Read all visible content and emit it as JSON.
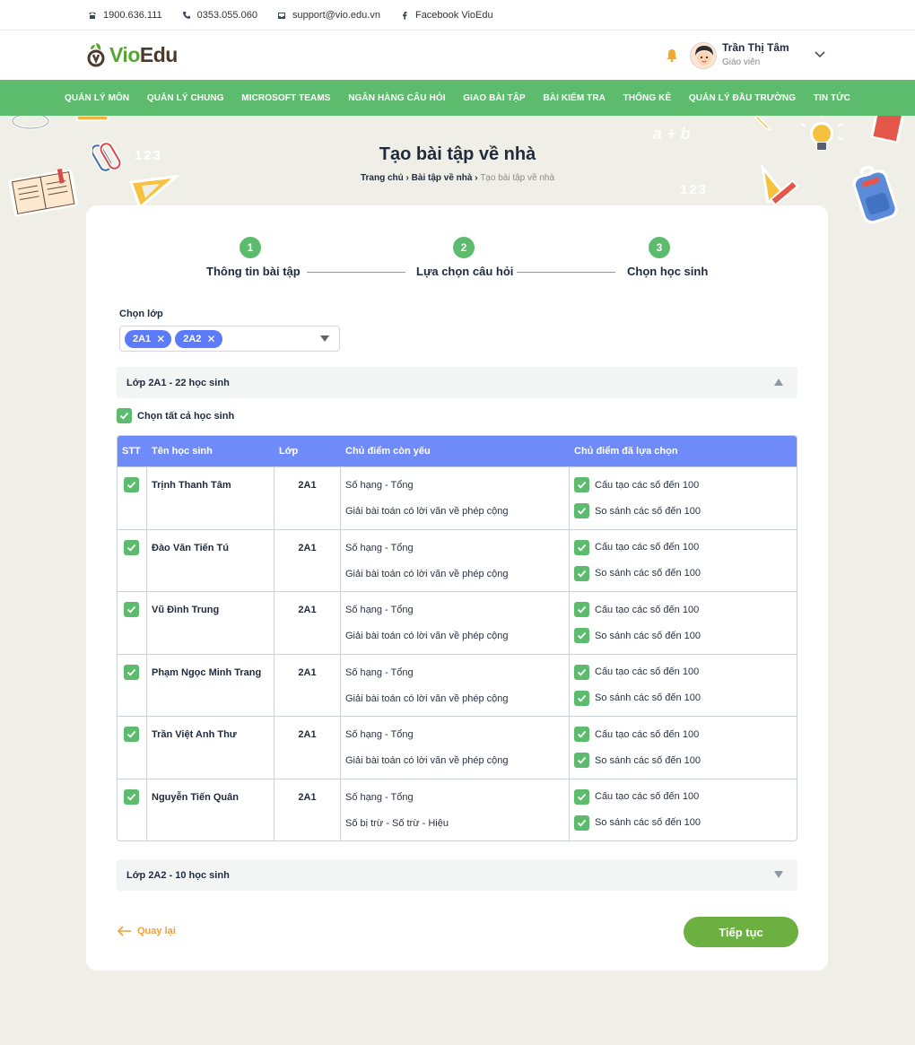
{
  "contact": {
    "hotline": "1900.636.111",
    "phone": "0353.055.060",
    "email": "support@vio.edu.vn",
    "facebook": "Facebook VioEdu"
  },
  "brand": {
    "logo_part1": "Vio",
    "logo_part2": "Edu"
  },
  "user": {
    "name": "Trần Thị Tâm",
    "role": "Giáo viên"
  },
  "nav": [
    "Quản lý môn",
    "Quản lý chung",
    "Microsoft Teams",
    "Ngân hàng câu hỏi",
    "Giao bài tập",
    "Bài kiểm tra",
    "Thống kê",
    "Quản lý đầu trường",
    "Tin tức"
  ],
  "page": {
    "title": "Tạo bài tập về nhà",
    "breadcrumb": {
      "home": "Trang chủ",
      "sep": "›",
      "parent": "Bài tập về nhà",
      "current": "Tạo bài tập về nhà"
    }
  },
  "steps": [
    {
      "num": "1",
      "label": "Thông tin bài tập"
    },
    {
      "num": "2",
      "label": "Lựa chọn câu hỏi"
    },
    {
      "num": "3",
      "label": "Chọn học sinh"
    }
  ],
  "class_select": {
    "label": "Chọn lớp",
    "chips": [
      "2A1",
      "2A2"
    ],
    "remove_symbol": "✕"
  },
  "group1": {
    "title": "Lớp 2A1 - 22 học sinh",
    "select_all": "Chọn tất cả học sinh"
  },
  "table": {
    "headers": [
      "STT",
      "Tên học sinh",
      "Lớp",
      "Chủ điểm còn yếu",
      "Chủ điểm đã lựa chọn"
    ],
    "rows": [
      {
        "name": "Trịnh Thanh Tâm",
        "class": "2A1",
        "weak": [
          "Số hạng - Tổng",
          "Giải bài toán có lời văn về phép cộng"
        ],
        "chosen": [
          "Cấu tạo các số đến 100",
          "So sánh các số đến 100"
        ]
      },
      {
        "name": "Đào Văn Tiến Tú",
        "class": "2A1",
        "weak": [
          "Số hạng - Tổng",
          "Giải bài toán có lời văn về phép cộng"
        ],
        "chosen": [
          "Cấu tạo các số đến 100",
          "So sánh các số đến 100"
        ]
      },
      {
        "name": "Vũ Đình Trung",
        "class": "2A1",
        "weak": [
          "Số hạng - Tổng",
          "Giải bài toán có lời văn về phép cộng"
        ],
        "chosen": [
          "Cấu tạo các số đến 100",
          "So sánh các số đến 100"
        ]
      },
      {
        "name": "Phạm Ngọc Minh Trang",
        "class": "2A1",
        "weak": [
          "Số hạng - Tổng",
          "Giải bài toán có lời văn về phép cộng"
        ],
        "chosen": [
          "Cấu tạo các số đến 100",
          "So sánh các số đến 100"
        ]
      },
      {
        "name": "Trần Việt Anh Thư",
        "class": "2A1",
        "weak": [
          "Số hạng - Tổng",
          "Giải bài toán có lời văn về phép cộng"
        ],
        "chosen": [
          "Cấu tạo các số đến 100",
          "So sánh các số đến 100"
        ]
      },
      {
        "name": "Nguyễn Tiến Quân",
        "class": "2A1",
        "weak": [
          "Số hạng - Tổng",
          "Số bị trừ - Số trừ - Hiệu"
        ],
        "chosen": [
          "Cấu tạo các số đến 100",
          "So sánh các số đến 100"
        ]
      }
    ]
  },
  "group2": {
    "title": "Lớp 2A2 - 10 học sinh"
  },
  "actions": {
    "back": "Quay lại",
    "next": "Tiếp tục"
  },
  "deco_text": {
    "nums1": "123",
    "nums2": "123",
    "formula": "a + b"
  },
  "colors": {
    "green": "#5dbb6e",
    "blue": "#6f8bfa",
    "chip": "#5b7bfa",
    "orange": "#f0a03c",
    "button": "#6cb041"
  }
}
